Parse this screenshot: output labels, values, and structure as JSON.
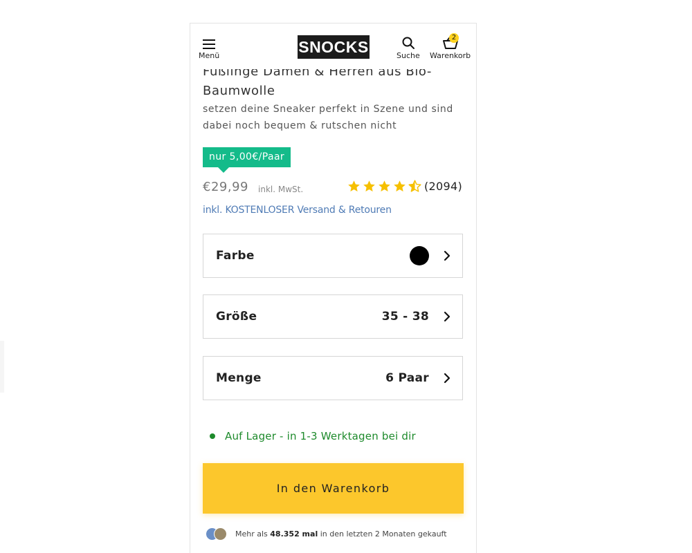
{
  "header": {
    "menu_label": "Menü",
    "logo_text": "SNOCKS",
    "search_label": "Suche",
    "cart_label": "Warenkorb",
    "cart_count": "2"
  },
  "product": {
    "title": "Füßlinge Damen & Herren aus Bio-Baumwolle",
    "subtitle": "setzen deine Sneaker perfekt in Szene und sind dabei noch bequem & rutschen nicht",
    "promo": "nur 5,00€/Paar",
    "price": "€29,99",
    "vat": "inkl. MwSt.",
    "rating_value": 4.5,
    "rating_count": "(2094)",
    "shipping": "inkl. KOSTENLOSER Versand & Retouren"
  },
  "options": {
    "color_label": "Farbe",
    "color_value": "#000000",
    "size_label": "Größe",
    "size_value": "35 - 38",
    "quantity_label": "Menge",
    "quantity_value": "6 Paar"
  },
  "stock": {
    "text": "Auf Lager - in 1-3 Werktagen bei dir"
  },
  "cta": {
    "label": "In den Warenkorb"
  },
  "social_proof": {
    "prefix": "Mehr als",
    "count": "48.352 mal",
    "suffix": "in den letzten 2 Monaten gekauft"
  },
  "colors": {
    "accent_yellow": "#fcc72c",
    "promo_green": "#14bb8a",
    "stock_green": "#1d8a2b",
    "link_blue": "#4f7bb5",
    "star_yellow": "#f6c000"
  }
}
